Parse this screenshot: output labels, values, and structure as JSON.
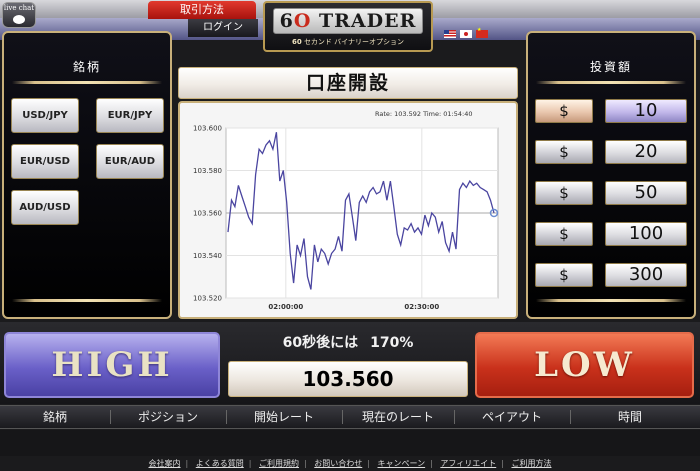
{
  "header": {
    "live_chat": "live chat",
    "howto": "取引方法",
    "login": "ログイン",
    "logo_prefix": "6",
    "logo_o": "O",
    "logo_name": "TRADER",
    "tagline_num": "60",
    "tagline": "セカンド バイナリーオプション",
    "flags": [
      "us-flag-icon",
      "jp-flag-icon",
      "cn-flag-icon"
    ]
  },
  "symbols": {
    "title": "銘柄",
    "pairs": [
      "USD/JPY",
      "EUR/JPY",
      "EUR/USD",
      "EUR/AUD",
      "AUD/USD"
    ]
  },
  "investment": {
    "title": "投資額",
    "currency": "$",
    "amounts": [
      "10",
      "20",
      "50",
      "100",
      "300"
    ],
    "selected_amount": "10"
  },
  "center": {
    "open_account": "口座開設"
  },
  "chart_data": {
    "type": "line",
    "rate_label": "Rate: 103.592 Time: 01:54:40",
    "x_ticks": [
      "02:00:00",
      "02:30:00"
    ],
    "y_ticks": [
      "103.600",
      "103.580",
      "103.560",
      "103.540",
      "103.520"
    ],
    "ylim": [
      103.52,
      103.6
    ],
    "strike_rate": 103.56,
    "series": [
      {
        "values": [
          103.551,
          103.566,
          103.563,
          103.573,
          103.568,
          103.563,
          103.558,
          103.555,
          103.578,
          103.59,
          103.588,
          103.592,
          103.594,
          103.59,
          103.598,
          103.575,
          103.58,
          103.565,
          103.541,
          103.527,
          103.545,
          103.54,
          103.548,
          103.53,
          103.524,
          103.545,
          103.537,
          103.543,
          103.541,
          103.536,
          103.541,
          103.543,
          103.549,
          103.542,
          103.566,
          103.569,
          103.558,
          103.547,
          103.565,
          103.568,
          103.565,
          103.57,
          103.572,
          103.569,
          103.57,
          103.575,
          103.566,
          103.575,
          103.563,
          103.55,
          103.545,
          103.553,
          103.552,
          103.555,
          103.551,
          103.553,
          103.55,
          103.559,
          103.554,
          103.56,
          103.558,
          103.551,
          103.556,
          103.546,
          103.542,
          103.551,
          103.543,
          103.571,
          103.574,
          103.572,
          103.575,
          103.573,
          103.574,
          103.572,
          103.571,
          103.57,
          103.566,
          103.56
        ]
      }
    ]
  },
  "trade": {
    "high_label": "HIGH",
    "low_label": "LOW",
    "payout_text": "60秒後には",
    "payout_pct": "170%",
    "current_rate": "103.560"
  },
  "columns": [
    "銘柄",
    "ポジション",
    "開始レート",
    "現在のレート",
    "ペイアウト",
    "時間"
  ],
  "footer": {
    "links": [
      "会社案内",
      "よくある質問",
      "ご利用規約",
      "お問い合わせ",
      "キャンペーン",
      "アフィリエイト",
      "ご利用方法"
    ]
  }
}
